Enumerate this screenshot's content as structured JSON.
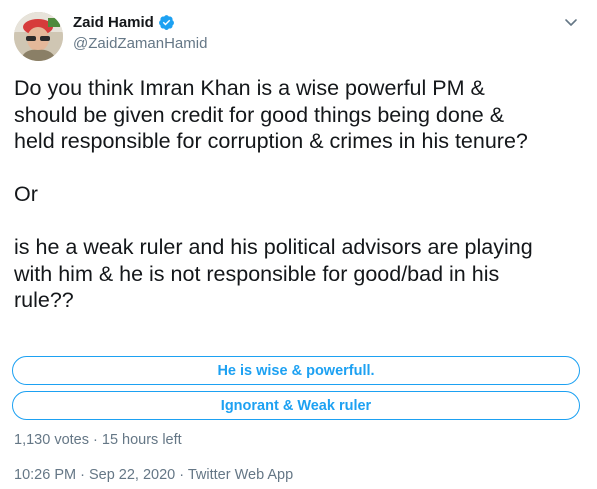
{
  "author": {
    "name": "Zaid Hamid",
    "handle": "@ZaidZamanHamid",
    "verified": true
  },
  "tweet": {
    "text": "Do you think Imran Khan is a wise powerful PM &\nshould be given credit for good things being done &\nheld responsible for corruption & crimes in his tenure?\n\nOr\n\nis he a weak ruler and his political advisors are playing\nwith him & he is not responsible for good/bad in his\nrule??"
  },
  "poll": {
    "options": [
      {
        "label": "He is wise & powerfull."
      },
      {
        "label": "Ignorant & Weak ruler"
      }
    ],
    "votes": "1,130 votes",
    "separator": " · ",
    "time_left": "15 hours left"
  },
  "meta": {
    "time": "10:26 PM",
    "date": "Sep 22, 2020",
    "source": "Twitter Web App",
    "separator": " · "
  },
  "colors": {
    "accent": "#1da1f2",
    "muted": "#657786",
    "text": "#14171a"
  },
  "icons": {
    "verified": "verified-badge-icon",
    "caret": "chevron-down-icon"
  }
}
